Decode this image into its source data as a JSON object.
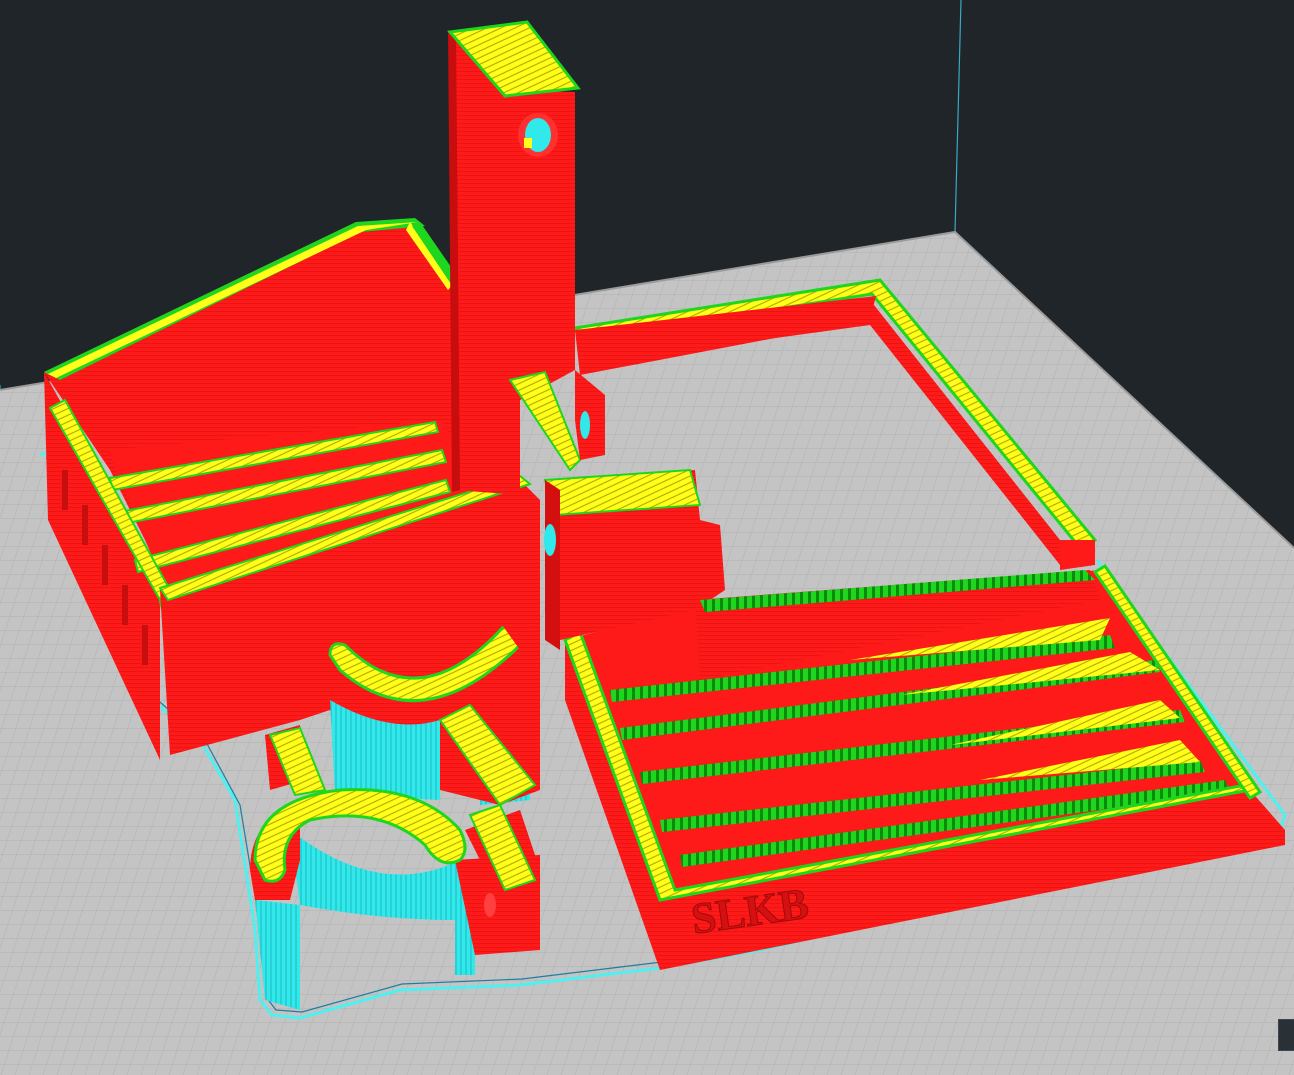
{
  "app": {
    "view": "layer-preview",
    "background_color": "#1f2528"
  },
  "scene": {
    "engraved_label": "SLKB",
    "colors": {
      "outer_wall": "#ff1a1a",
      "inner_wall": "#1fd61f",
      "infill": "#ffff1a",
      "support": "#2ff2f2",
      "skirt": "#4ff0f0",
      "build_plate": "#c4c4c4",
      "build_plate_grid": "#b0b0b0",
      "build_volume_edge": "#3aa8c8"
    },
    "objects": [
      "tall-tower-bracket",
      "angled-tray",
      "square-frame",
      "slotted-base-plate",
      "pipe-clamp-upper",
      "pipe-clamp-lower",
      "central-block"
    ]
  }
}
